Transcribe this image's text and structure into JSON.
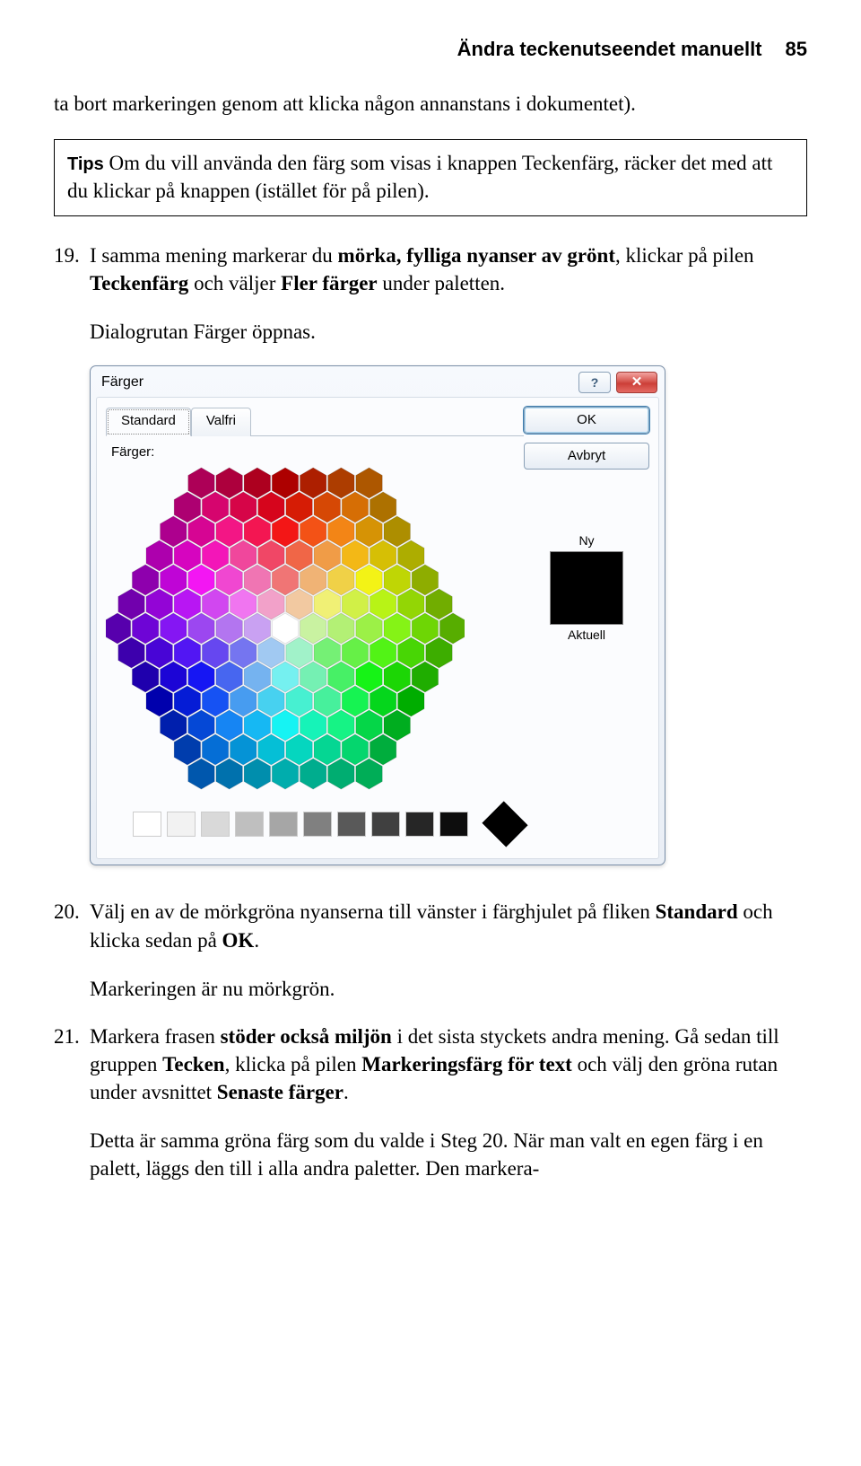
{
  "header": {
    "title": "Ändra teckenutseendet manuellt",
    "page": "85"
  },
  "pre_para": "ta bort markeringen genom att klicka någon annanstans i dokumentet).",
  "tip": {
    "label": "Tips",
    "text": " Om du vill använda den färg som visas i knappen Teckenfärg, räcker det med att du klickar på knappen (istället för på pilen)."
  },
  "item19": {
    "num": "19.",
    "pre": "I samma mening markerar du ",
    "bold1": "mörka, fylliga nyanser av grönt",
    "mid": ", klickar på pilen ",
    "b2": "Teckenfärg",
    "mid2": " och väljer ",
    "b3": "Fler färger",
    "post": " under paletten."
  },
  "caption19": "Dialogrutan Färger öppnas.",
  "dialog": {
    "title": "Färger",
    "help_icon": "?",
    "close_icon": "✕",
    "tab_standard": "Standard",
    "tab_custom": "Valfri",
    "colors_label": "Färger:",
    "ok": "OK",
    "cancel": "Avbryt",
    "new_label": "Ny",
    "current_label": "Aktuell",
    "bw": [
      "#ffffff",
      "#f2f2f2",
      "#d9d9d9",
      "#bfbfbf",
      "#a6a6a6",
      "#808080",
      "#595959",
      "#404040",
      "#262626",
      "#0d0d0d"
    ]
  },
  "item20": {
    "num": "20.",
    "pre": "Välj en av de mörkgröna nyanserna till vänster i färghjulet på fliken ",
    "b1": "Standard",
    "mid": " och klicka sedan på ",
    "b2": "OK",
    "post": "."
  },
  "caption20": "Markeringen är nu mörkgrön.",
  "item21": {
    "num": "21.",
    "pre": "Markera frasen ",
    "b1": "stöder också miljön",
    "mid": " i det sista styckets andra mening. Gå sedan till gruppen ",
    "b2": "Tecken",
    "mid2": ", klicka på pilen ",
    "b3": "Markeringsfärg för text",
    "mid3": " och välj den gröna rutan under avsnittet ",
    "b4": "Senaste färger",
    "post": "."
  },
  "caption21": "Detta är samma gröna färg som du valde i Steg 20. När man valt en egen färg i en palett, läggs den till i alla andra paletter. Den markera-"
}
